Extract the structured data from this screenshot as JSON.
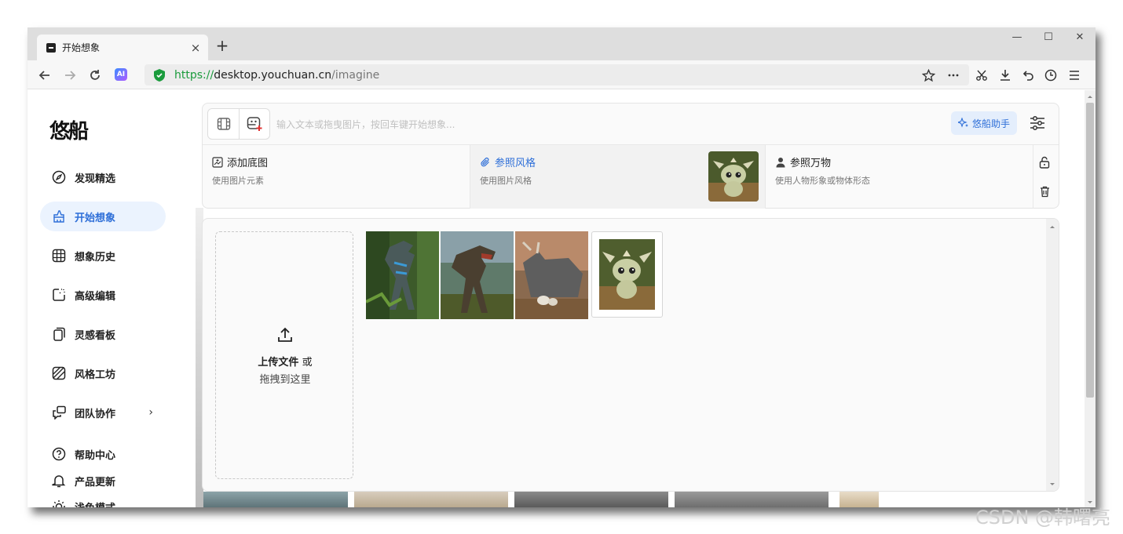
{
  "browser": {
    "tab_title": "开始想象",
    "url_scheme": "https://",
    "url_host": "desktop.youchuan.cn",
    "url_path": "/imagine",
    "new_tab": "+",
    "close_tab": "×",
    "minimize": "—",
    "maximize": "☐",
    "close_window": "✕",
    "ai_badge": "AI"
  },
  "sidebar": {
    "logo": "悠船",
    "items": [
      {
        "label": "发现精选",
        "icon": "compass-icon"
      },
      {
        "label": "开始想象",
        "icon": "brush-icon",
        "active": true
      },
      {
        "label": "想象历史",
        "icon": "grid-icon"
      },
      {
        "label": "高级编辑",
        "icon": "edit-frame-icon"
      },
      {
        "label": "灵感看板",
        "icon": "copy-icon"
      },
      {
        "label": "风格工坊",
        "icon": "hatch-icon"
      },
      {
        "label": "团队协作",
        "icon": "chat-icon",
        "chevron": "›"
      }
    ],
    "bottom": [
      {
        "label": "帮助中心",
        "icon": "help-icon"
      },
      {
        "label": "产品更新",
        "icon": "bell-icon"
      },
      {
        "label": "浅色模式",
        "icon": "sun-icon"
      }
    ]
  },
  "prompt": {
    "placeholder": "输入文本或拖曳图片，按回车键开始想象...",
    "assist_label": "悠船助手"
  },
  "references": [
    {
      "title": "添加底图",
      "subtitle": "使用图片元素",
      "icon": "image-add-icon"
    },
    {
      "title": "参照风格",
      "subtitle": "使用图片风格",
      "icon": "paperclip-icon",
      "active": true
    },
    {
      "title": "参照万物",
      "subtitle": "使用人物形象或物体形态",
      "icon": "person-icon"
    }
  ],
  "upload": {
    "line1_bold": "上传文件",
    "line1_rest": " 或",
    "line2": "拖拽到这里"
  },
  "images": [
    {
      "name": "dinosaur-raptor-thumb",
      "selected": false
    },
    {
      "name": "dinosaur-trex-thumb",
      "selected": false
    },
    {
      "name": "dinosaur-triceratops-thumb",
      "selected": false
    },
    {
      "name": "baby-dragon-thumb",
      "selected": true
    }
  ],
  "watermark": "CSDN @韩曙亮",
  "colors": {
    "accent": "#2e6fd8",
    "active_bg": "#ebf3fe",
    "https_green": "#1a9b3c"
  }
}
